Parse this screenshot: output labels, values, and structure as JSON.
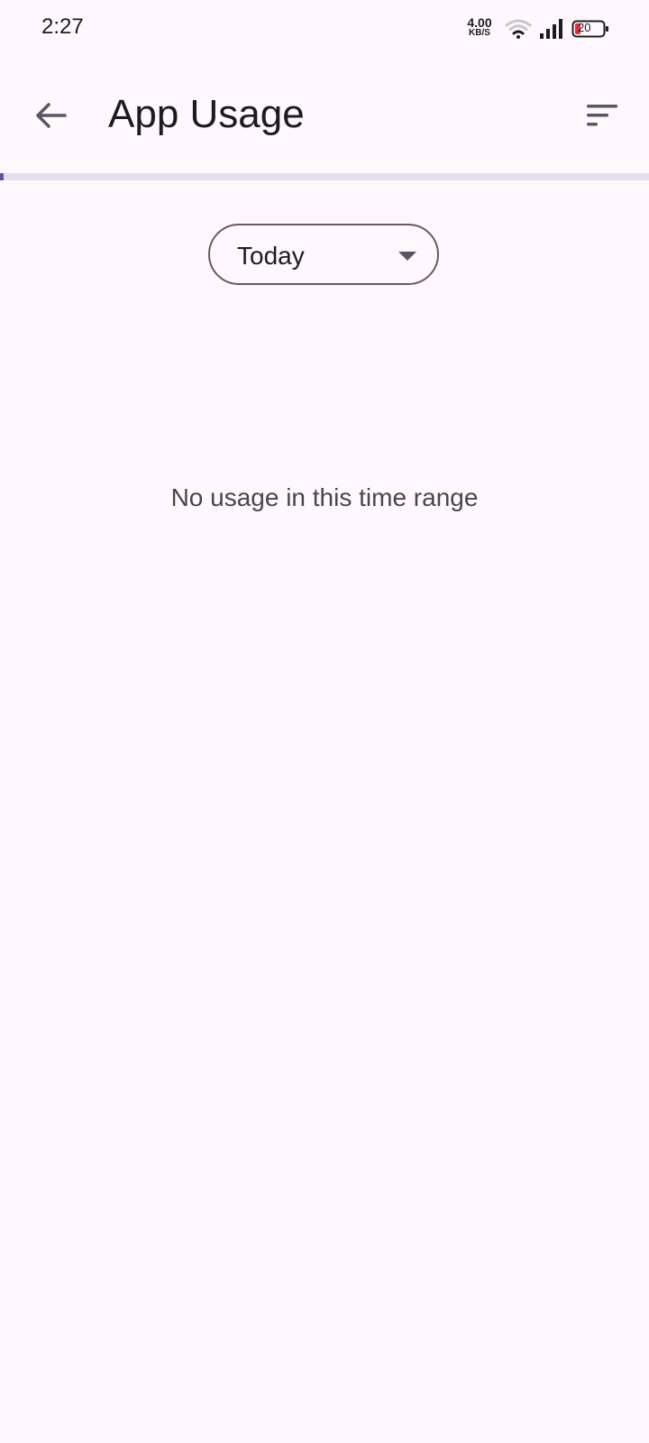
{
  "status_bar": {
    "time": "2:27",
    "net_speed_value": "4.00",
    "net_speed_unit": "KB/S",
    "battery_level": "20",
    "icons": [
      "wifi-icon",
      "signal-icon",
      "battery-icon"
    ]
  },
  "app_bar": {
    "title": "App Usage",
    "back_icon": "arrow-left-icon",
    "sort_icon": "sort-icon"
  },
  "progress": {
    "fraction": 0.005
  },
  "filter": {
    "selected": "Today",
    "icon": "dropdown-triangle-icon"
  },
  "empty_state": {
    "message": "No usage in this time range"
  },
  "colors": {
    "background": "#fef8fc",
    "accent": "#6750a4",
    "track": "#e3dfee",
    "battery_low": "#e0303b"
  }
}
